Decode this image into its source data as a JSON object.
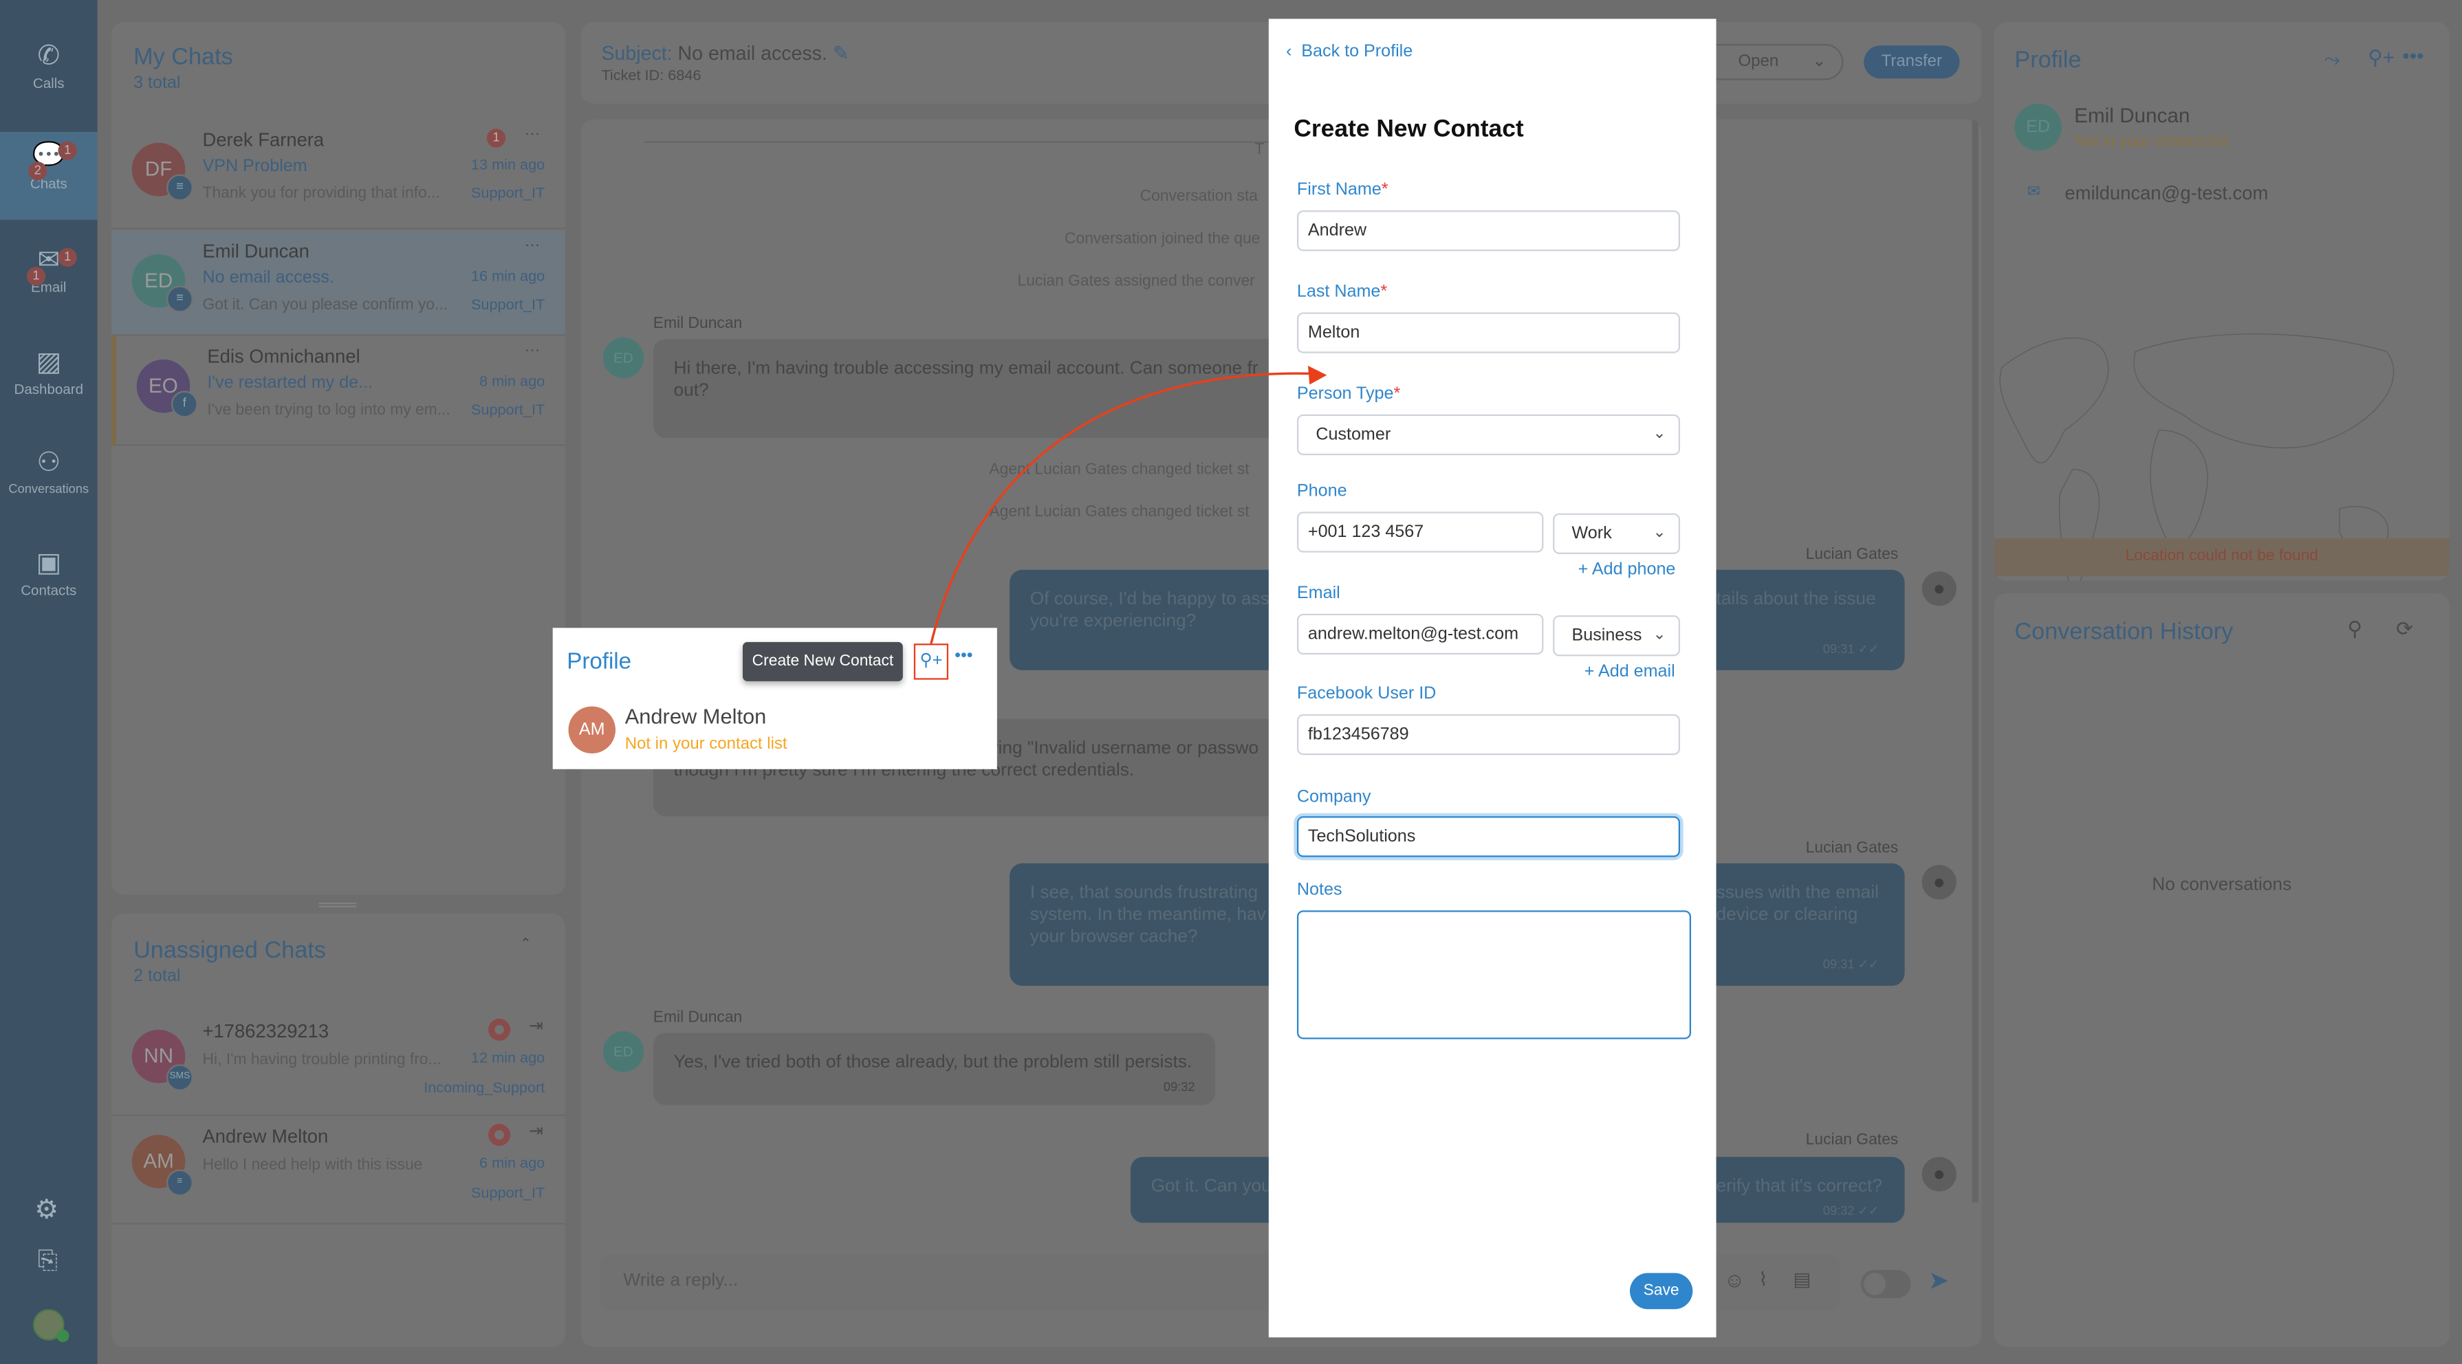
{
  "sidebar": {
    "items": [
      {
        "label": "Calls",
        "icon": "phone-icon"
      },
      {
        "label": "Chats",
        "icon": "chat-icon",
        "badges": [
          "1",
          "2"
        ]
      },
      {
        "label": "Email",
        "icon": "email-icon",
        "badges": [
          "1",
          "1"
        ]
      },
      {
        "label": "Dashboard",
        "icon": "dashboard-icon"
      },
      {
        "label": "Conversations",
        "icon": "people-icon"
      },
      {
        "label": "Contacts",
        "icon": "contacts-icon"
      }
    ]
  },
  "my_chats": {
    "title": "My Chats",
    "total": "3 total",
    "items": [
      {
        "initials": "DF",
        "name": "Derek Farnera",
        "subject": "VPN Problem",
        "preview": "Thank you for providing that info...",
        "time": "13 min ago",
        "queue": "Support_IT",
        "unread": "1",
        "more": "···"
      },
      {
        "initials": "ED",
        "name": "Emil Duncan",
        "subject": "No email access.",
        "preview": "Got it. Can you please confirm yo...",
        "time": "16 min ago",
        "queue": "Support_IT",
        "more": "···"
      },
      {
        "initials": "EO",
        "name": "Edis Omnichannel",
        "subject": "I've restarted my de...",
        "preview": "I've been trying to log into my em...",
        "time": "8 min ago",
        "queue": "Support_IT",
        "more": "···"
      }
    ]
  },
  "unassigned": {
    "title": "Unassigned Chats",
    "total": "2 total",
    "items": [
      {
        "initials": "NN",
        "name": "+17862329213",
        "preview": "Hi, I'm having trouble printing fro...",
        "time": "12 min ago",
        "queue": "Incoming_Support",
        "channel": "SMS"
      },
      {
        "initials": "AM",
        "name": "Andrew Melton",
        "preview": "Hello I need help with this issue",
        "time": "6 min ago",
        "queue": "Support_IT"
      }
    ]
  },
  "ticket": {
    "subject_label": "Subject:",
    "subject": "No email access.",
    "ticket_id": "Ticket ID: 6846",
    "status": "Open",
    "transfer": "Transfer"
  },
  "conversation": {
    "system": [
      "T",
      "Conversation sta",
      "Conversation joined the que",
      "Lucian Gates assigned the conver",
      "Agent Lucian Gates changed ticket st",
      "Agent Lucian Gates changed ticket st"
    ],
    "messages": [
      {
        "sender": "Emil Duncan",
        "initials": "ED",
        "lines": [
          "Hi there, I'm having trouble accessing my email account. Can someone fr",
          "out?"
        ]
      },
      {
        "sender": "Lucian Gates",
        "left": [
          "Of course, I'd be happy to assi",
          "you're experiencing?"
        ],
        "right": [
          "tails about the issue"
        ],
        "time": "09:31"
      },
      {
        "lines": [
          "ying \"Invalid username or passwo",
          "though I'm pretty sure I'm entering the correct credentials."
        ]
      },
      {
        "sender": "Lucian Gates",
        "left": [
          "I see, that sounds frustrating",
          "system. In the meantime, hav",
          "your browser cache?"
        ],
        "right": [
          "ssues with the email",
          "device or clearing"
        ],
        "time": "09:31"
      },
      {
        "sender": "Emil Duncan",
        "initials": "ED",
        "lines": [
          "Yes, I've tried both of those already, but the problem still persists."
        ],
        "time": "09:32"
      },
      {
        "sender": "Lucian Gates",
        "left": [
          "Got it. Can you"
        ],
        "right": [
          "erify that it's correct?"
        ],
        "time": "09:32"
      }
    ],
    "reply_placeholder": "Write a reply..."
  },
  "profile_panel": {
    "title": "Profile",
    "initials": "ED",
    "name": "Emil Duncan",
    "status": "Not in your contact list",
    "email": "emilduncan@g-test.com",
    "location_error": "Location could not be found"
  },
  "history": {
    "title": "Conversation History",
    "empty": "No conversations"
  },
  "callout": {
    "title": "Profile",
    "tooltip": "Create New Contact",
    "initials": "AM",
    "name": "Andrew Melton",
    "status": "Not in your contact list"
  },
  "form": {
    "back": "Back to Profile",
    "title": "Create New Contact",
    "first_name": {
      "label": "First Name",
      "value": "Andrew"
    },
    "last_name": {
      "label": "Last Name",
      "value": "Melton"
    },
    "person_type": {
      "label": "Person Type",
      "value": "Customer"
    },
    "phone": {
      "label": "Phone",
      "value": "+001 123 4567",
      "type": "Work",
      "add": "+ Add phone"
    },
    "email": {
      "label": "Email",
      "value": "andrew.melton@g-test.com",
      "type": "Business",
      "add": "+ Add email"
    },
    "facebook": {
      "label": "Facebook User ID",
      "value": "fb123456789"
    },
    "company": {
      "label": "Company",
      "value": "TechSolutions"
    },
    "notes": {
      "label": "Notes",
      "value": ""
    },
    "required_mark": "*",
    "save": "Save"
  },
  "colors": {
    "accent": "#2f86cc",
    "annotation": "#e8401c",
    "warning": "#f5a623",
    "dim_overlay": "#6d6d6d"
  }
}
